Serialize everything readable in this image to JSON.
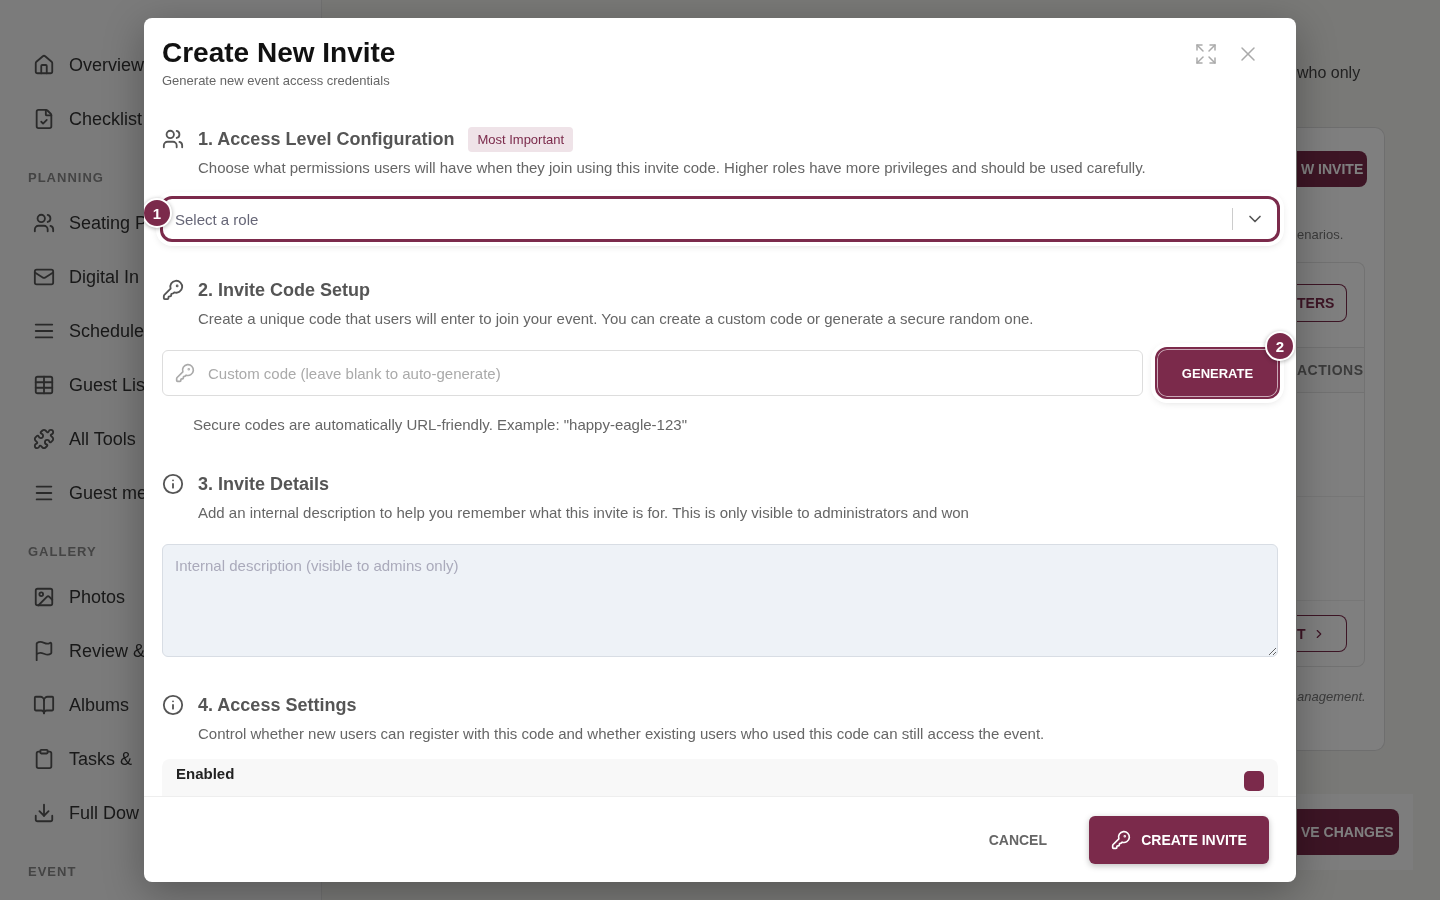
{
  "sidebar": {
    "items": [
      {
        "kind": "item",
        "label": "Overview"
      },
      {
        "kind": "item",
        "label": "Checklist"
      },
      {
        "kind": "section",
        "label": "PLANNING"
      },
      {
        "kind": "item",
        "label": "Seating P"
      },
      {
        "kind": "item",
        "label": "Digital In"
      },
      {
        "kind": "item",
        "label": "Schedule"
      },
      {
        "kind": "item",
        "label": "Guest Lis"
      },
      {
        "kind": "item",
        "label": "All Tools"
      },
      {
        "kind": "item",
        "label": "Guest me"
      },
      {
        "kind": "section",
        "label": "GALLERY"
      },
      {
        "kind": "item",
        "label": "Photos"
      },
      {
        "kind": "item",
        "label": "Review &"
      },
      {
        "kind": "item",
        "label": "Albums"
      },
      {
        "kind": "item",
        "label": "Tasks &"
      },
      {
        "kind": "item",
        "label": "Full Dow"
      },
      {
        "kind": "section",
        "label": "EVENT"
      }
    ]
  },
  "page": {
    "intro_text": "who only",
    "new_invite_button": "W INVITE",
    "note": "enarios.",
    "filters_button": "TERS",
    "table_header": "ACTIONS",
    "next_button": "T",
    "footnote": "anagement.",
    "save_button": "VE CHANGES"
  },
  "dialog": {
    "title": "Create New Invite",
    "subtitle": "Generate new event access credentials",
    "sections": [
      {
        "kind": "select",
        "heading": "1. Access Level Configuration",
        "badge": "Most Important",
        "description": "Choose what permissions users will have when they join using this invite code. Higher roles have more privileges and should be used carefully.",
        "placeholder": "Select a role",
        "step": "1"
      },
      {
        "kind": "code",
        "heading": "2. Invite Code Setup",
        "description": "Create a unique code that users will enter to join your event. You can create a custom code or generate a secure random one.",
        "placeholder": "Custom code (leave blank to auto-generate)",
        "button": "GENERATE",
        "step": "2",
        "helper": "Secure codes are automatically URL-friendly. Example: \"happy-eagle-123\""
      },
      {
        "kind": "textarea",
        "heading": "3. Invite Details",
        "description": "Add an internal description to help you remember what this invite is for. This is only visible to administrators and won",
        "placeholder": "Internal description (visible to admins only)"
      },
      {
        "kind": "toggles",
        "heading": "4. Access Settings",
        "description": "Control whether new users can register with this code and whether existing users who used this code can still access the event.",
        "options": [
          {
            "label": "Enabled",
            "on": true
          }
        ]
      }
    ],
    "cancel_button": "CANCEL",
    "create_button": "CREATE INVITE"
  }
}
